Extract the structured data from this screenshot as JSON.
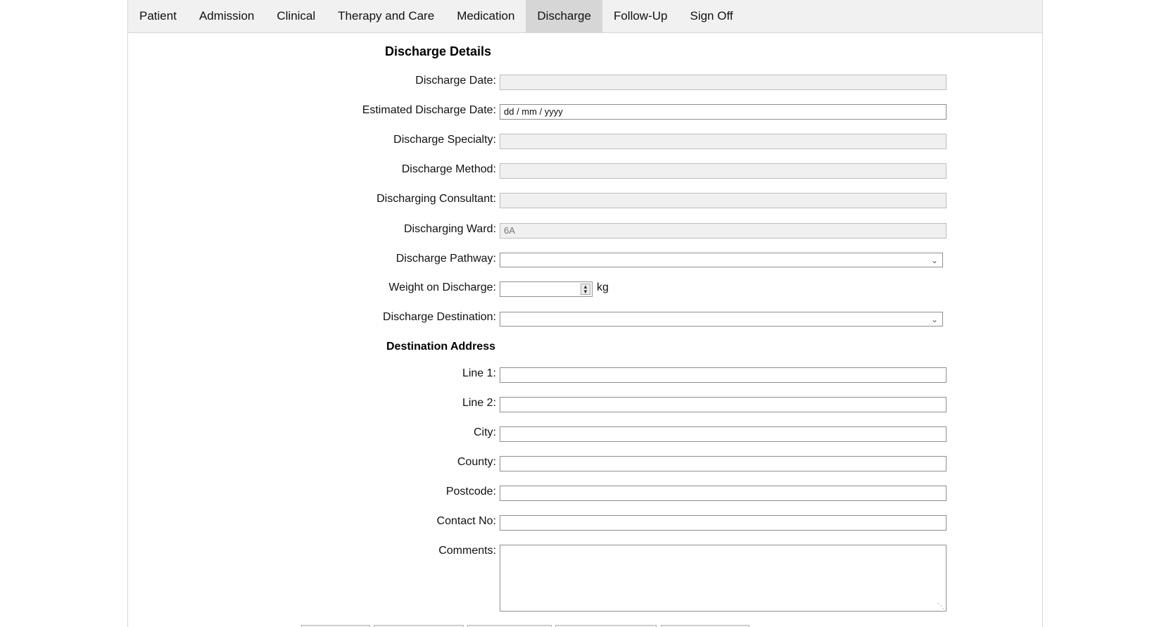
{
  "tabs": [
    {
      "label": "Patient"
    },
    {
      "label": "Admission"
    },
    {
      "label": "Clinical"
    },
    {
      "label": "Therapy and Care"
    },
    {
      "label": "Medication"
    },
    {
      "label": "Discharge",
      "active": true
    },
    {
      "label": "Follow-Up"
    },
    {
      "label": "Sign Off"
    }
  ],
  "discharge": {
    "heading": "Discharge Details",
    "discharge_date_label": "Discharge Date:",
    "discharge_date_value": "",
    "estimated_date_label": "Estimated Discharge Date:",
    "estimated_date_placeholder": "dd / mm / yyyy",
    "specialty_label": "Discharge Specialty:",
    "specialty_value": "",
    "method_label": "Discharge Method:",
    "method_value": "",
    "consultant_label": "Discharging Consultant:",
    "consultant_value": "",
    "ward_label": "Discharging Ward:",
    "ward_value": "6A",
    "pathway_label": "Discharge Pathway:",
    "pathway_value": "",
    "weight_label": "Weight on Discharge:",
    "weight_value": "",
    "weight_unit": "kg",
    "destination_label": "Discharge Destination:",
    "destination_value": ""
  },
  "address": {
    "heading": "Destination Address",
    "line1_label": "Line 1:",
    "line2_label": "Line 2:",
    "city_label": "City:",
    "county_label": "County:",
    "postcode_label": "Postcode:",
    "contact_label": "Contact No:",
    "comments_label": "Comments:"
  }
}
